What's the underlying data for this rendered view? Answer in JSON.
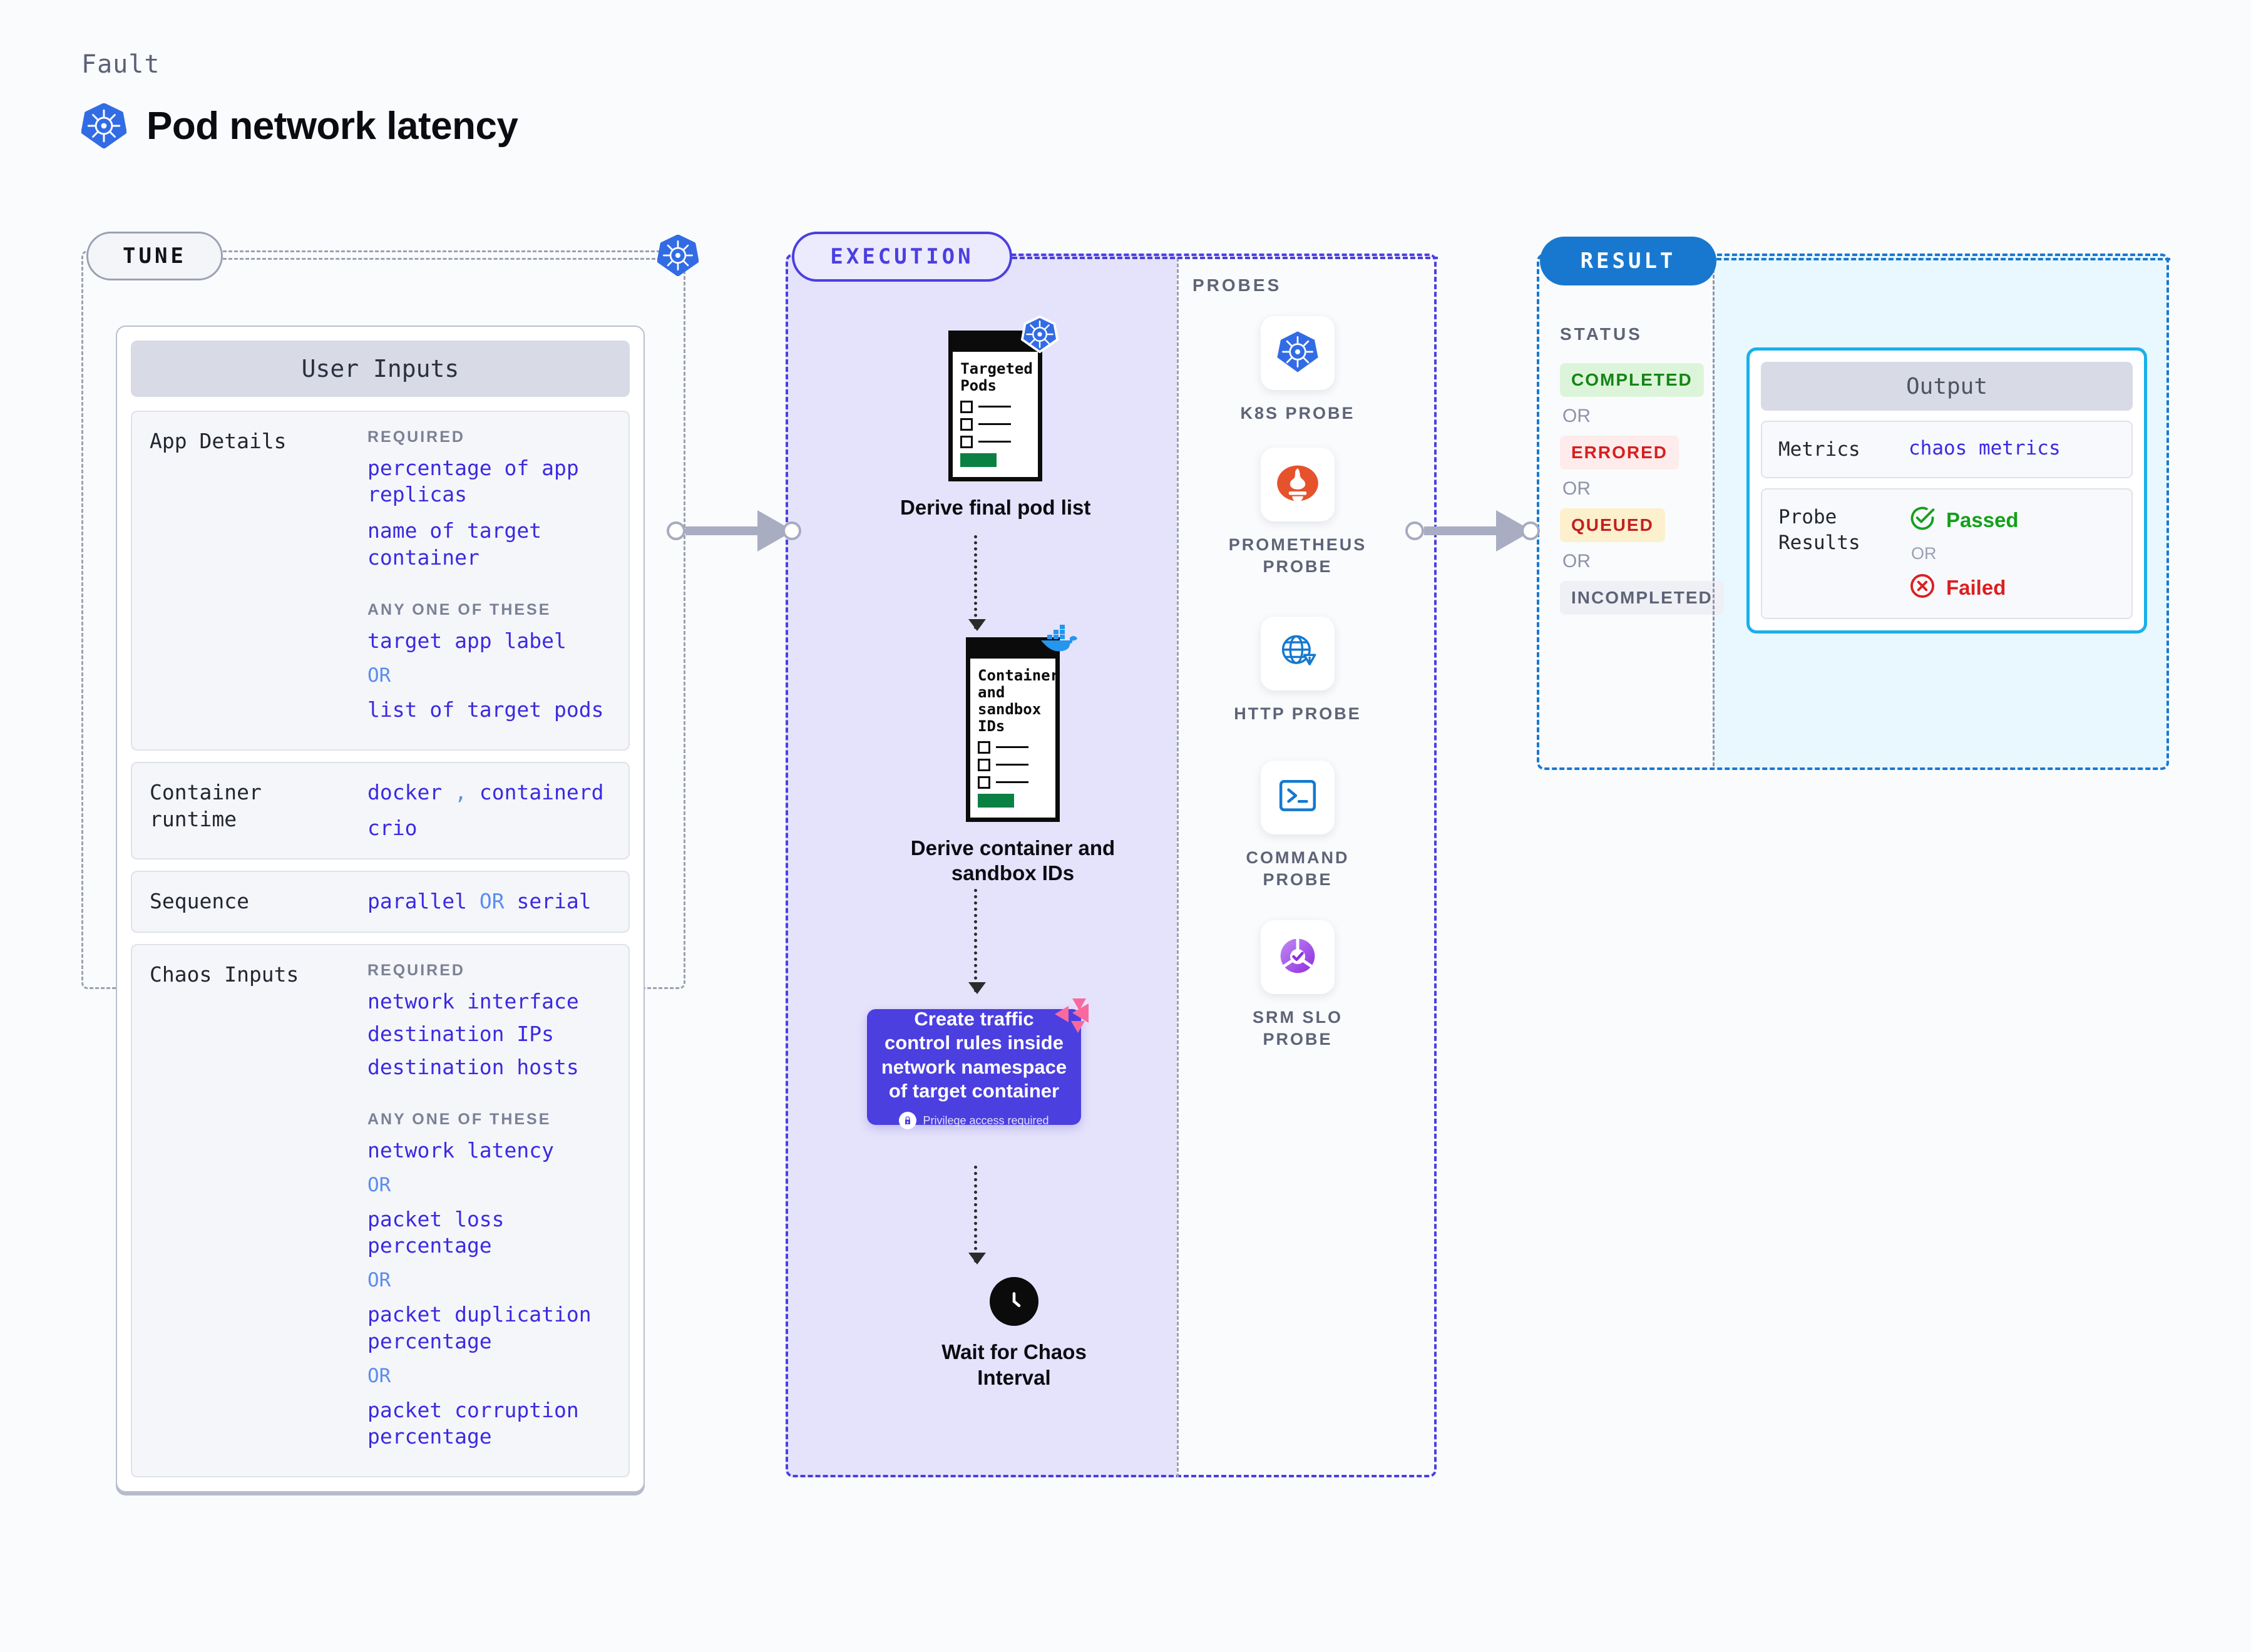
{
  "header": {
    "eyebrow": "Fault",
    "title": "Pod network latency",
    "icon": "kubernetes-icon"
  },
  "tune": {
    "pill_label": "TUNE",
    "badge_icon": "kubernetes-icon",
    "card_title": "User Inputs",
    "sections": [
      {
        "key": "App Details",
        "groups": [
          {
            "caption": "REQUIRED",
            "values": [
              "percentage of app replicas",
              "name of target container"
            ]
          },
          {
            "caption": "ANY ONE OF THESE",
            "values": [
              "target app label",
              "OR",
              "list of target pods"
            ]
          }
        ]
      },
      {
        "key": "Container runtime",
        "inline": {
          "values": [
            "docker",
            "containerd",
            "crio"
          ],
          "separator": ","
        }
      },
      {
        "key": "Sequence",
        "inline_or": {
          "left": "parallel",
          "op": "OR",
          "right": "serial"
        }
      },
      {
        "key": "Chaos Inputs",
        "groups": [
          {
            "caption": "REQUIRED",
            "values": [
              "network interface",
              "destination IPs",
              "destination hosts"
            ]
          },
          {
            "caption": "ANY ONE OF THESE",
            "values": [
              "network latency",
              "OR",
              "packet loss percentage",
              "OR",
              "packet duplication percentage",
              "OR",
              "packet corruption percentage"
            ]
          }
        ]
      }
    ]
  },
  "execution": {
    "pill_label": "EXECUTION",
    "nodes": [
      {
        "doc_title": "Targeted Pods",
        "caption": "Derive final pod list",
        "badge_icon": "kubernetes-icon"
      },
      {
        "doc_title": "Container and sandbox IDs",
        "caption": "Derive container and sandbox IDs",
        "badge_icon": "docker-icon"
      }
    ],
    "action": {
      "text": "Create traffic control rules inside network namespace of target container",
      "privilege_note": "Privilege access required",
      "privilege_icon": "lock-icon",
      "badge_icon": "litmus-icon",
      "color": "#4b3fe0"
    },
    "wait": {
      "caption": "Wait for Chaos Interval",
      "icon": "clock-icon"
    }
  },
  "probes": {
    "label": "PROBES",
    "items": [
      {
        "name": "K8S PROBE",
        "icon": "kubernetes-icon"
      },
      {
        "name": "PROMETHEUS PROBE",
        "icon": "prometheus-icon"
      },
      {
        "name": "HTTP PROBE",
        "icon": "globe-warning-icon"
      },
      {
        "name": "COMMAND PROBE",
        "icon": "terminal-icon"
      },
      {
        "name": "SRM SLO PROBE",
        "icon": "srm-slo-icon"
      }
    ]
  },
  "result": {
    "pill_label": "RESULT",
    "status_label": "STATUS",
    "statuses": [
      {
        "text": "COMPLETED",
        "bg": "#dcf5da",
        "fg": "#158515"
      },
      {
        "text": "OR",
        "divider": true
      },
      {
        "text": "ERRORED",
        "bg": "#fdeceb",
        "fg": "#d61f1f"
      },
      {
        "text": "OR",
        "divider": true
      },
      {
        "text": "QUEUED",
        "bg": "#fcf0cd",
        "fg": "#c32020"
      },
      {
        "text": "OR",
        "divider": true
      },
      {
        "text": "INCOMPLETED",
        "bg": "#eff0f5",
        "fg": "#5e6477"
      }
    ],
    "output": {
      "title": "Output",
      "rows": [
        {
          "key": "Metrics",
          "value": "chaos metrics"
        }
      ],
      "probe_results": {
        "key": "Probe Results",
        "passed": {
          "text": "Passed",
          "color": "#14a01b",
          "icon": "check-circle-icon"
        },
        "or": "OR",
        "failed": {
          "text": "Failed",
          "color": "#dc1f1f",
          "icon": "x-circle-icon"
        }
      }
    }
  },
  "connectors": [
    {
      "name": "tune-to-execution"
    },
    {
      "name": "probes-to-result"
    }
  ]
}
